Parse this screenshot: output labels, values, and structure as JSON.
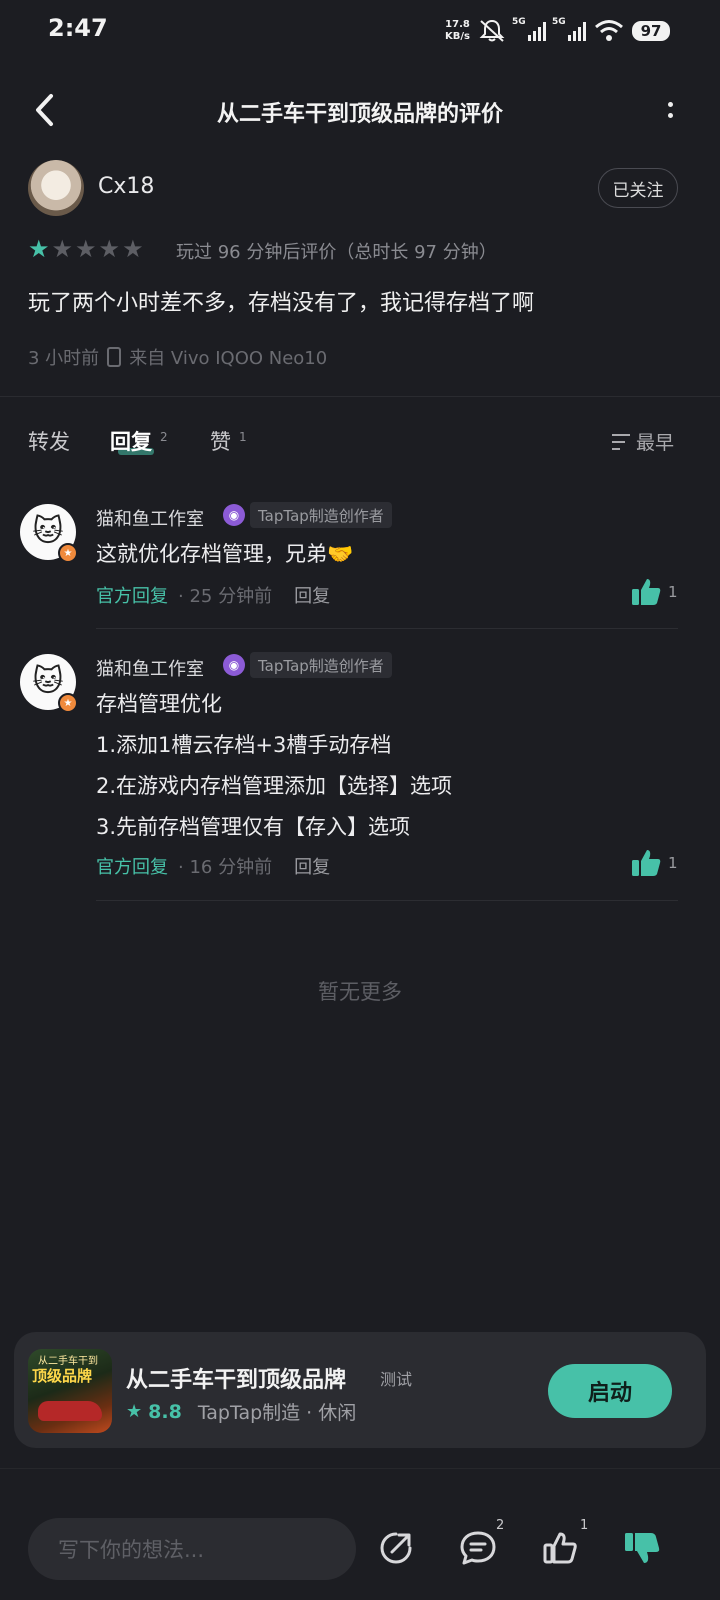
{
  "status_bar": {
    "time": "2:47",
    "net_speed_value": "17.8",
    "net_speed_unit": "KB/s",
    "signal1_label": "5G",
    "signal2_label": "5G",
    "battery": "97"
  },
  "header": {
    "title": "从二手车干到顶级品牌的评价"
  },
  "review": {
    "author": "Cx18",
    "follow_label": "已关注",
    "rating": 1,
    "rating_max": 5,
    "play_info": "玩过 96 分钟后评价（总时长 97 分钟）",
    "text": "玩了两个小时差不多，存档没有了，我记得存档了啊",
    "time": "3 小时前",
    "device": "来自 Vivo IQOO Neo10"
  },
  "tabs": {
    "repost": "转发",
    "reply": "回复",
    "reply_count": "2",
    "like": "赞",
    "like_count": "1",
    "sort": "最早"
  },
  "replies": [
    {
      "author": "猫和鱼工作室",
      "tag": "TapTap制造创作者",
      "lines": [
        "这就优化存档管理，兄弟🤝"
      ],
      "official": "官方回复",
      "time": "· 25 分钟前",
      "reply_label": "回复",
      "likes": "1"
    },
    {
      "author": "猫和鱼工作室",
      "tag": "TapTap制造创作者",
      "lines": [
        "存档管理优化",
        "1.添加1槽云存档+3槽手动存档",
        "2.在游戏内存档管理添加【选择】选项",
        "3.先前存档管理仅有【存入】选项"
      ],
      "official": "官方回复",
      "time": "· 16 分钟前",
      "reply_label": "回复",
      "likes": "1"
    }
  ],
  "no_more": "暂无更多",
  "game_card": {
    "icon_subtitle": "从二手车干到",
    "icon_title": "顶级品牌",
    "name": "从二手车干到顶级品牌",
    "badge": "测试",
    "rating": "8.8",
    "tags": "TapTap制造 · 休闲",
    "launch_label": "启动"
  },
  "bottom_bar": {
    "input_placeholder": "写下你的想法...",
    "comment_count": "2",
    "like_count": "1"
  },
  "colors": {
    "accent": "#47c1a8",
    "background": "#1c1d22",
    "card": "#2b2c31"
  }
}
